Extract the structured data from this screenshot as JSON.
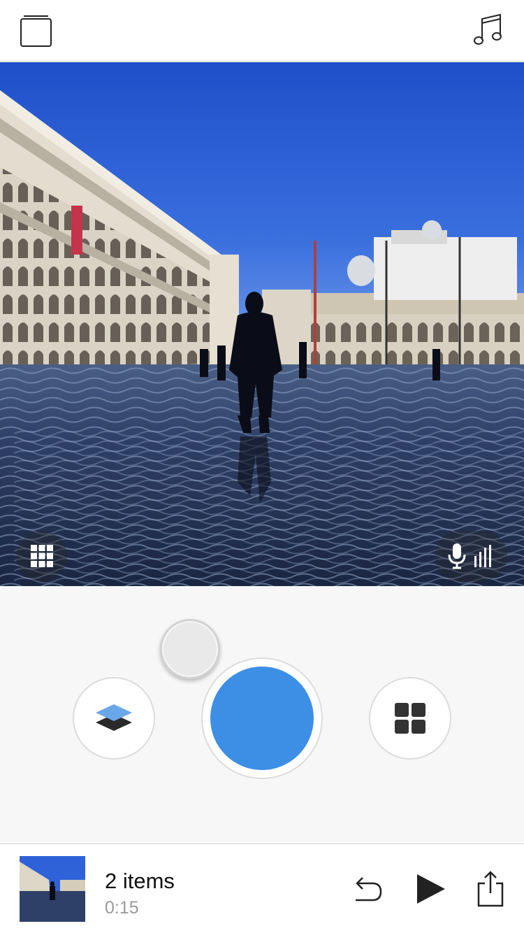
{
  "top_bar": {
    "left_icon": "projects-folder-icon",
    "right_icon": "music-note-icon"
  },
  "preview": {
    "grid_overlay_icon": "grid-icon",
    "mic_overlay_icons": [
      "microphone-icon",
      "audio-levels-icon"
    ]
  },
  "controls": {
    "layers_icon": "layers-icon",
    "record_icon": "record-icon",
    "layouts_icon": "four-squares-icon",
    "accent_color": "#3d8fe6"
  },
  "bottom_bar": {
    "items_label": "2 items",
    "duration": "0:15",
    "icons": [
      "undo-icon",
      "play-icon",
      "share-icon"
    ]
  }
}
